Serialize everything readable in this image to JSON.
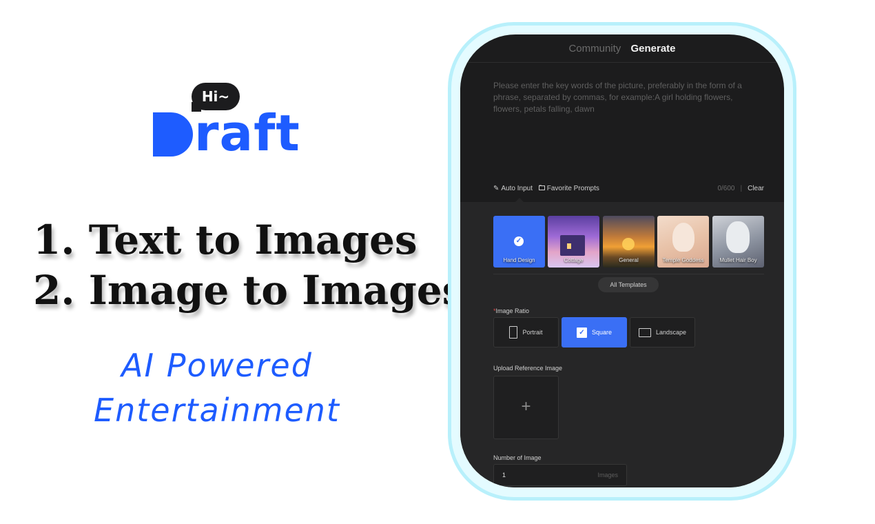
{
  "logo": {
    "bubble": "Hi~",
    "word_rest": "raft"
  },
  "features": [
    "1. Text to Images",
    "2. Image to Images"
  ],
  "tagline": [
    "AI Powered",
    "Entertainment"
  ],
  "app": {
    "tabs": [
      {
        "label": "Community",
        "active": false
      },
      {
        "label": "Generate",
        "active": true
      }
    ],
    "prompt_placeholder": "Please enter the key words of the picture, preferably in the form of a phrase, separated by commas, for example:A girl holding flowers, flowers, petals falling, dawn",
    "tools": {
      "auto_input": "Auto Input",
      "favorite_prompts": "Favorite Prompts"
    },
    "counter": "0/600",
    "clear_label": "Clear",
    "templates": [
      {
        "label": "Hand Design",
        "selected": true
      },
      {
        "label": "Cottage",
        "selected": false
      },
      {
        "label": "General",
        "selected": false
      },
      {
        "label": "Temple Goddess",
        "selected": false
      },
      {
        "label": "Mullet Hair Boy",
        "selected": false
      }
    ],
    "all_templates_label": "All Templates",
    "image_ratio_label": "Image Ratio",
    "ratios": [
      {
        "label": "Portrait",
        "icon": "portrait-icon",
        "selected": false
      },
      {
        "label": "Square",
        "icon": "square-check-icon",
        "selected": true
      },
      {
        "label": "Landscape",
        "icon": "landscape-icon",
        "selected": false
      }
    ],
    "upload_label": "Upload Reference Image",
    "upload_icon": "plus-icon",
    "number_label": "Number of Image",
    "number_value": "1",
    "number_unit": "Images"
  },
  "colors": {
    "brand_blue": "#1e5cff",
    "active_blue": "#3a6ff5",
    "phone_bg": "#1c1c1d",
    "glow": "#b8f0fb"
  }
}
